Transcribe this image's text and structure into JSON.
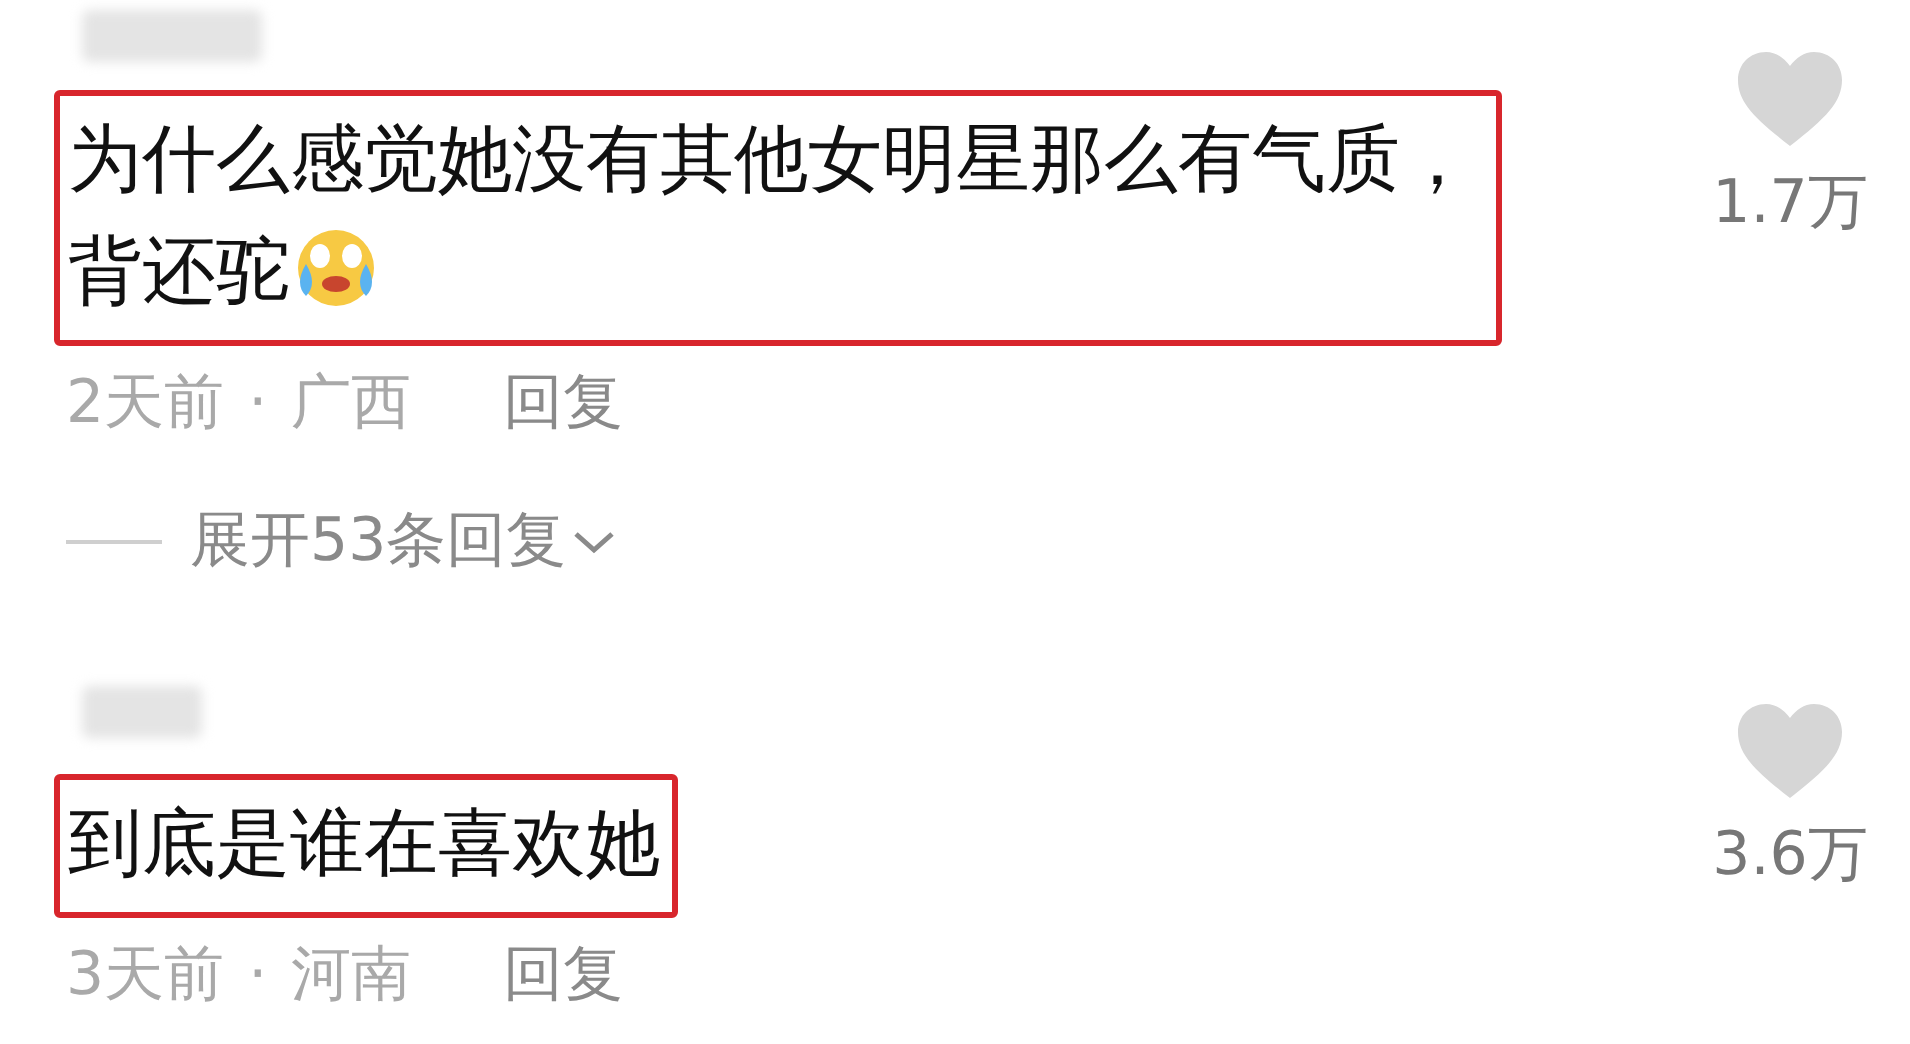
{
  "comments": [
    {
      "text": "为什么感觉她没有其他女明星那么有气质，背还驼",
      "trailing_emoji": true,
      "highlighted": true,
      "likes": "1.7万",
      "time": "2天前",
      "separator": "·",
      "location": "广西",
      "reply": "回复",
      "expand": "展开53条回复"
    },
    {
      "text": "到底是谁在喜欢她",
      "trailing_emoji": false,
      "highlighted": true,
      "likes": "3.6万",
      "time": "3天前",
      "separator": "·",
      "location": "河南",
      "reply": "回复"
    }
  ]
}
